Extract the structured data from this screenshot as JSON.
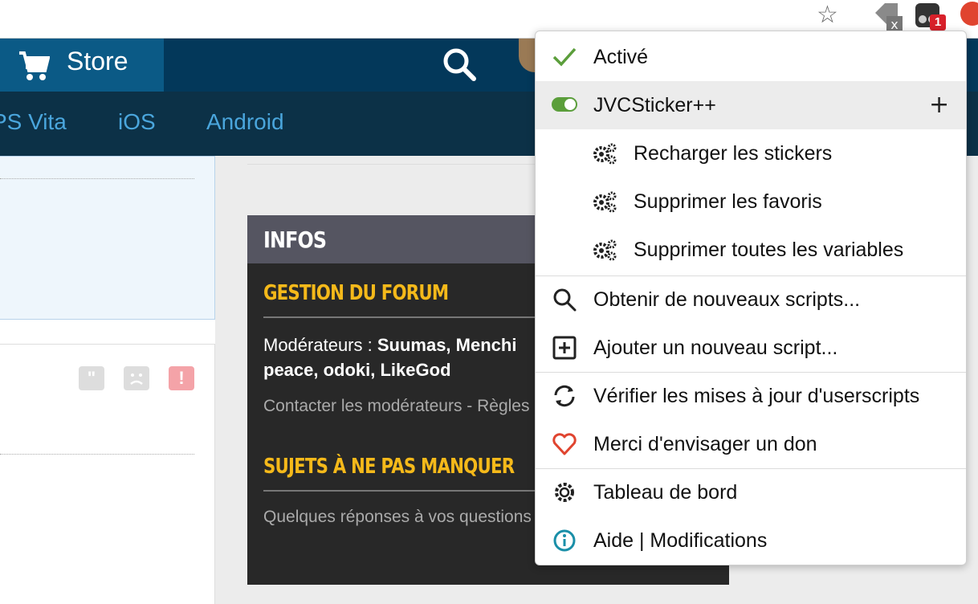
{
  "site": {
    "store_label": "Store",
    "nav_items": [
      "PS Vita",
      "iOS",
      "Android"
    ]
  },
  "infos": {
    "title": "INFOS",
    "section1_title": "GESTION DU FORUM",
    "moderators_label": "Modérateurs : ",
    "moderators_line1": "Suumas, Menchi",
    "moderators_line2": "peace, odoki, LikeGod",
    "contact_text": "Contacter les modérateurs - Règles",
    "section2_title": "SUJETS À NE PAS MANQUER",
    "section2_text": "Quelques réponses à vos questions"
  },
  "extension": {
    "badge_count": "1",
    "menu": {
      "enabled_label": "Activé",
      "script_name": "JVCSticker++",
      "script_actions": [
        "Recharger les stickers",
        "Supprimer les favoris",
        "Supprimer toutes les variables"
      ],
      "get_scripts": "Obtenir de nouveaux scripts...",
      "add_script": "Ajouter un nouveau script...",
      "check_updates": "Vérifier les mises à jour d'userscripts",
      "donate": "Merci d'envisager un don",
      "dashboard": "Tableau de bord",
      "help": "Aide | Modifications"
    }
  },
  "colors": {
    "check_green": "#5b9e3b",
    "heart_red": "#e0442f",
    "info_teal": "#1a8fa8",
    "infos_title_yellow": "#f5b91a"
  }
}
